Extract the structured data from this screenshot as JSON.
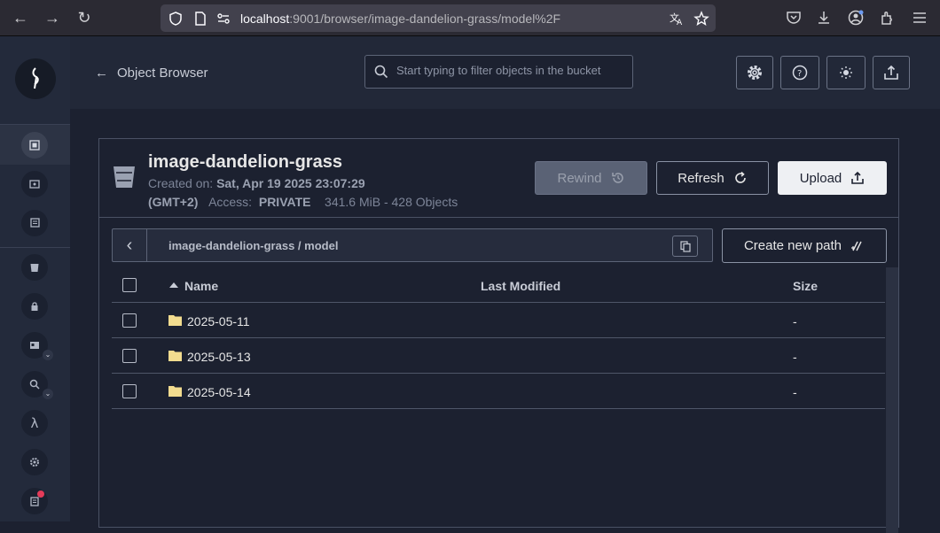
{
  "browser": {
    "url_host": "localhost",
    "url_rest": ":9001/browser/image-dandelion-grass/model%2F"
  },
  "header": {
    "back_label": "Object Browser",
    "search_placeholder": "Start typing to filter objects in the bucket"
  },
  "bucket": {
    "name": "image-dandelion-grass",
    "created_label": "Created on:",
    "created_value": "Sat, Apr 19 2025 23:07:29",
    "timezone": "(GMT+2)",
    "access_label": "Access:",
    "access_value": "PRIVATE",
    "summary": "341.6 MiB - 428 Objects"
  },
  "actions": {
    "rewind": "Rewind",
    "refresh": "Refresh",
    "upload": "Upload",
    "create_path": "Create new path"
  },
  "breadcrumb": {
    "path": "image-dandelion-grass  /  model"
  },
  "table": {
    "columns": [
      "Name",
      "Last Modified",
      "Size"
    ],
    "rows": [
      {
        "name": "2025-05-11",
        "modified": "",
        "size": "-"
      },
      {
        "name": "2025-05-13",
        "modified": "",
        "size": "-"
      },
      {
        "name": "2025-05-14",
        "modified": "",
        "size": "-"
      }
    ]
  },
  "colors": {
    "background": "#1c2130",
    "sidebar": "#232a3b",
    "accent_badge": "#e53c5a",
    "folder": "#f2dc8f"
  }
}
